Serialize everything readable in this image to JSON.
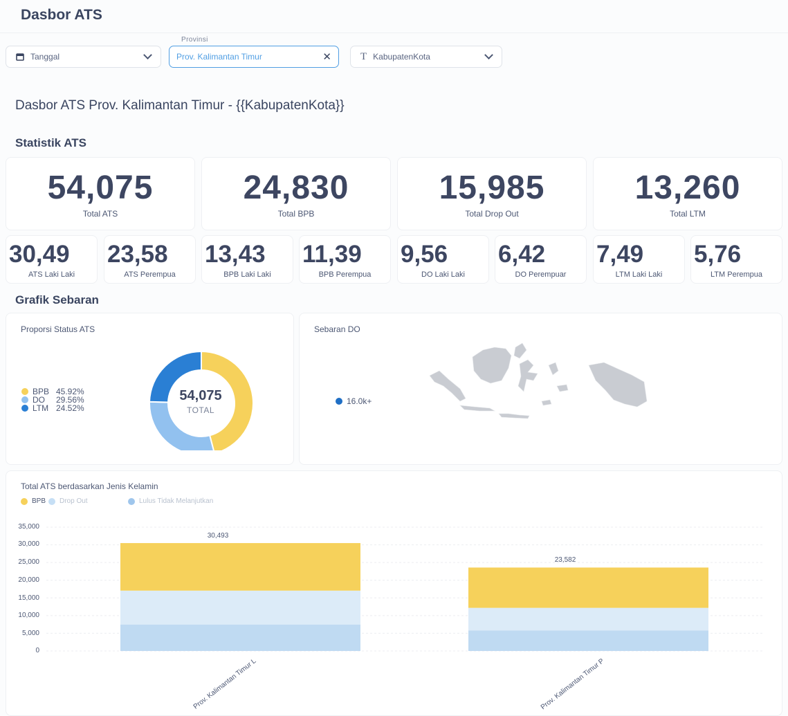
{
  "app_title": "Dasbor ATS",
  "filters": {
    "tanggal": {
      "label": "Tanggal"
    },
    "provinsi": {
      "caption": "Provinsi",
      "value": "Prov. Kalimantan Timur"
    },
    "kabupaten": {
      "label": "KabupatenKota"
    }
  },
  "dashboard_heading": "Dasbor ATS Prov. Kalimantan Timur - {{KabupatenKota}}",
  "statistik_heading": "Statistik ATS",
  "big_stats": [
    {
      "value": "54,075",
      "label": "Total ATS"
    },
    {
      "value": "24,830",
      "label": "Total BPB"
    },
    {
      "value": "15,985",
      "label": "Total Drop Out"
    },
    {
      "value": "13,260",
      "label": "Total LTM"
    }
  ],
  "small_stats": [
    {
      "value": "30,49",
      "label": "ATS Laki Laki"
    },
    {
      "value": "23,58",
      "label": "ATS Perempua"
    },
    {
      "value": "13,43",
      "label": "BPB Laki Laki"
    },
    {
      "value": "11,39",
      "label": "BPB Perempua"
    },
    {
      "value": "9,56",
      "label": "DO Laki Laki"
    },
    {
      "value": "6,42",
      "label": "DO Perempuar"
    },
    {
      "value": "7,49",
      "label": "LTM Laki Laki"
    },
    {
      "value": "5,76",
      "label": "LTM Perempua"
    }
  ],
  "grafik_heading": "Grafik Sebaran",
  "donut_card": {
    "title": "Proporsi Status ATS",
    "total": "54,075",
    "total_label": "TOTAL",
    "legend": [
      {
        "name": "BPB",
        "pct": "45.92%",
        "color": "#f6d15b"
      },
      {
        "name": "DO",
        "pct": "29.56%",
        "color": "#92c1ef"
      },
      {
        "name": "LTM",
        "pct": "24.52%",
        "color": "#2a7fd4"
      }
    ]
  },
  "map_card": {
    "title": "Sebaran DO",
    "legend_label": "16.0k+",
    "legend_color": "#1f6fc5"
  },
  "chart_data": {
    "type": "bar",
    "stacked": true,
    "title": "Total ATS berdasarkan Jenis Kelamin",
    "categories": [
      "Prov. Kalimantan Timur L",
      "Prov. Kalimantan Timur P"
    ],
    "series": [
      {
        "name": "Lulus Tidak Melanjutkan",
        "color": "#bfdaf2",
        "values": [
          7494,
          5766
        ]
      },
      {
        "name": "Drop Out",
        "color": "#dcebf8",
        "values": [
          9562,
          6423
        ]
      },
      {
        "name": "BPB",
        "color": "#f6d15b",
        "values": [
          13437,
          11393
        ]
      }
    ],
    "legend_order": [
      "BPB",
      "Drop Out",
      "Lulus Tidak Melanjutkan"
    ],
    "totals": [
      "30,493",
      "23,582"
    ],
    "yticks": [
      "35,000",
      "30,000",
      "25,000",
      "20,000",
      "15,000",
      "10,000",
      "5,000",
      "0"
    ],
    "ylim": [
      0,
      35000
    ],
    "grid": true,
    "legend_position": "top-left"
  }
}
